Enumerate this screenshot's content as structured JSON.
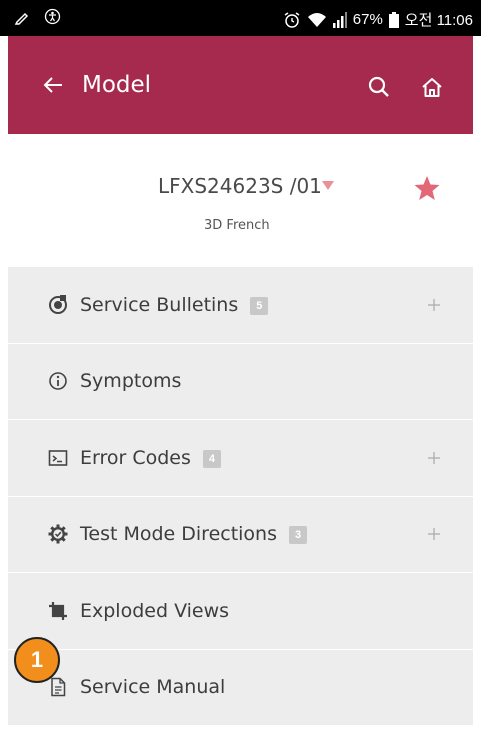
{
  "status_bar": {
    "battery": "67%",
    "time": "오전 11:06"
  },
  "app_bar": {
    "title": "Model"
  },
  "model": {
    "name": "LFXS24623S /01",
    "subtitle": "3D French"
  },
  "menu": [
    {
      "label": "Service Bulletins",
      "badge": "5",
      "icon": "service-bulletins-icon",
      "expandable": true
    },
    {
      "label": "Symptoms",
      "badge": null,
      "icon": "info-icon",
      "expandable": false
    },
    {
      "label": "Error Codes",
      "badge": "4",
      "icon": "terminal-icon",
      "expandable": true
    },
    {
      "label": "Test Mode Directions",
      "badge": "3",
      "icon": "gear-check-icon",
      "expandable": true
    },
    {
      "label": "Exploded Views",
      "badge": null,
      "icon": "crop-icon",
      "expandable": false
    },
    {
      "label": "Service Manual",
      "badge": null,
      "icon": "document-icon",
      "expandable": false
    }
  ],
  "annotation": {
    "number": "1"
  },
  "colors": {
    "app_bar": "#a52a4d",
    "accent_star": "#e26878",
    "list_bg": "#ededed",
    "callout": "#f28e1b"
  }
}
